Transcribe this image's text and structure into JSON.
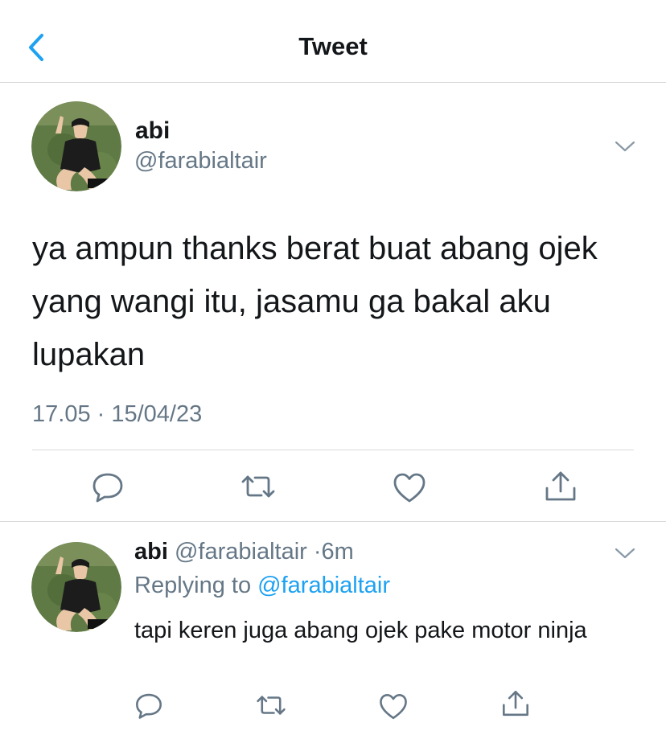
{
  "header": {
    "title": "Tweet",
    "back_icon": "chevron-left-icon",
    "accent_color": "#1da1f2"
  },
  "tweet": {
    "author_name": "abi",
    "author_handle": "@farabialtair",
    "text": "ya ampun thanks berat buat abang ojek yang wangi itu, jasamu ga bakal aku lupakan",
    "timestamp": "17.05 · 15/04/23",
    "actions": [
      "reply-icon",
      "retweet-icon",
      "like-icon",
      "share-icon"
    ]
  },
  "reply": {
    "author_name": "abi",
    "author_handle": "@farabialtair",
    "separator": "·",
    "time": "6m",
    "replying_to_label": "Replying to",
    "replying_to_handle": "@farabialtair",
    "text": "tapi keren juga abang ojek pake motor ninja",
    "actions": [
      "reply-icon",
      "retweet-icon",
      "like-icon",
      "share-icon"
    ]
  },
  "colors": {
    "text_primary": "#14171a",
    "text_secondary": "#657786",
    "link": "#1da1f2",
    "divider": "#d9d9d9"
  }
}
